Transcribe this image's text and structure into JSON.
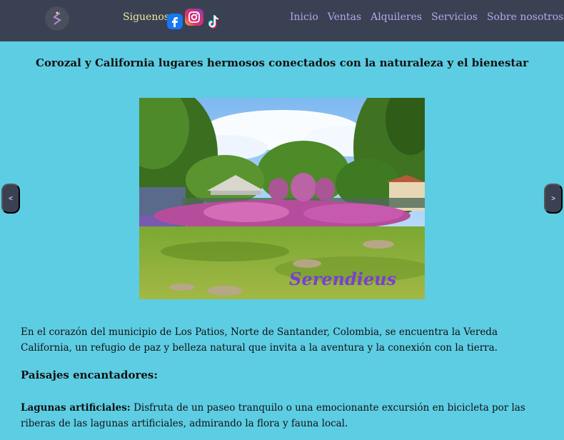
{
  "header": {
    "follow_label": "Siguenos",
    "social": [
      {
        "icon": "facebook-icon"
      },
      {
        "icon": "instagram-icon"
      },
      {
        "icon": "tiktok-icon"
      }
    ],
    "nav": [
      "Inicio",
      "Ventas",
      "Alquileres",
      "Servicios",
      "Sobre nosotros"
    ],
    "colors": {
      "bar": "#3a4152",
      "nav": "#b9a6ec",
      "follow": "#f0e8a0"
    }
  },
  "main": {
    "headline": "Corozal y California lugares hermosos conectados con la naturaleza y el bienestar",
    "carousel": {
      "prev_label": "<",
      "next_label": ">",
      "watermark": "Serendieus"
    },
    "intro": "En el corazón del municipio de Los Patios, Norte de Santander, Colombia, se encuentra la Vereda California, un refugio de paz y belleza natural que invita a la aventura y la conexión con la tierra.",
    "subhead": "Paisajes encantadores:",
    "feature_title": "Lagunas artificiales:",
    "feature_text": " Disfruta de un paseo tranquilo o una emocionante excursión en bicicleta por las riberas de las lagunas artificiales, admirando la flora y fauna local."
  },
  "colors": {
    "background": "#5dcde3"
  }
}
